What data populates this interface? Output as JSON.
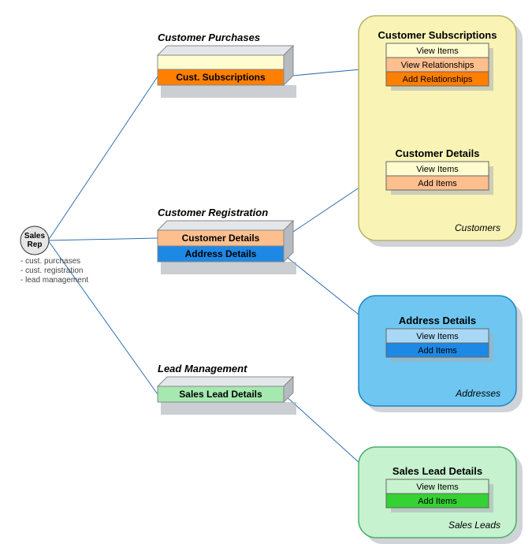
{
  "actor": {
    "name": "Sales Rep",
    "line1": "Sales",
    "line2": "Rep",
    "notes": [
      "- cust. purchases",
      "- cust. registration",
      "- lead management"
    ]
  },
  "blocks": {
    "purchases": {
      "title": "Customer Purchases",
      "rows": [
        "Cust. Subscriptions"
      ]
    },
    "registration": {
      "title": "Customer Registration",
      "rows": [
        "Customer Details",
        "Address Details"
      ]
    },
    "lead": {
      "title": "Lead Management",
      "rows": [
        "Sales Lead Details"
      ]
    }
  },
  "panels": {
    "customers": {
      "caption": "Customers",
      "sub_subscriptions": {
        "title": "Customer Subscriptions",
        "rows": [
          "View Items",
          "View Relationships",
          "Add Relationships"
        ]
      },
      "sub_details": {
        "title": "Customer Details",
        "rows": [
          "View Items",
          "Add Items"
        ]
      }
    },
    "addresses": {
      "caption": "Addresses",
      "sub": {
        "title": "Address Details",
        "rows": [
          "View Items",
          "Add Items"
        ]
      }
    },
    "salesleads": {
      "caption": "Sales Leads",
      "sub": {
        "title": "Sales Lead Details",
        "rows": [
          "View Items",
          "Add Items"
        ]
      }
    }
  },
  "colors": {
    "cream": "#FFFDD0",
    "orangeLight": "#FDBF8E",
    "orange": "#FF7F00",
    "orangeDark": "#E86100",
    "blueLighter": "#A9D8F6",
    "blueLight": "#4FC3F7",
    "blue": "#1E88E5",
    "greenLighter": "#C9F3CF",
    "greenLight": "#A5E8B0",
    "green": "#34D233",
    "custPanel": "#F9F3B6",
    "custPanelBorder": "#B8B26A",
    "addrPanel": "#6EC6F1",
    "addrPanelBorder": "#1E88C7",
    "leadPanel": "#C6F2CF",
    "leadPanelBorder": "#4CB06A",
    "shadow": "#A9AFB6",
    "side": "#B6BBC2",
    "top": "#E4E7EA",
    "line": "#2F6FB3",
    "actorFill": "#E6E6E6",
    "actorStroke": "#333"
  }
}
